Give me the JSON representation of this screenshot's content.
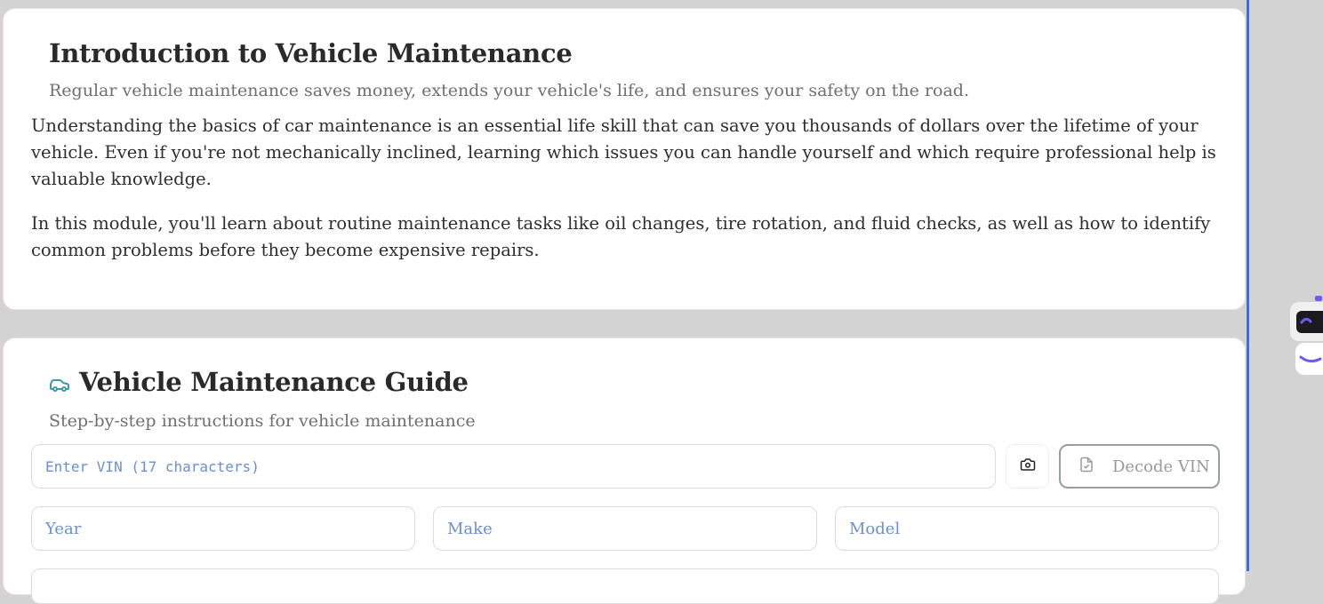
{
  "intro": {
    "title": "Introduction to Vehicle Maintenance",
    "subtitle": "Regular vehicle maintenance saves money, extends your vehicle's life, and ensures your safety on the road.",
    "paragraphs": [
      "Understanding the basics of car maintenance is an essential life skill that can save you thousands of dollars over the lifetime of your vehicle. Even if you're not mechanically inclined, learning which issues you can handle yourself and which require professional help is valuable knowledge.",
      "In this module, you'll learn about routine maintenance tasks like oil changes, tire rotation, and fluid checks, as well as how to identify common problems before they become expensive repairs."
    ]
  },
  "guide": {
    "title": "Vehicle Maintenance Guide",
    "subtitle": "Step-by-step instructions for vehicle maintenance",
    "vin": {
      "placeholder": "Enter VIN (17 characters)",
      "value": ""
    },
    "decode_label": "Decode VIN",
    "year": {
      "placeholder": "Year",
      "value": ""
    },
    "make": {
      "placeholder": "Make",
      "value": ""
    },
    "model": {
      "placeholder": "Model",
      "value": ""
    }
  },
  "icons": {
    "car": "car-icon",
    "camera": "camera-icon",
    "decode": "file-check-icon",
    "assistant": "robot-icon"
  },
  "colors": {
    "accent_teal": "#3a9aa8",
    "placeholder_blue": "#6a8fd0",
    "frame_blue": "#3b6fe0"
  }
}
